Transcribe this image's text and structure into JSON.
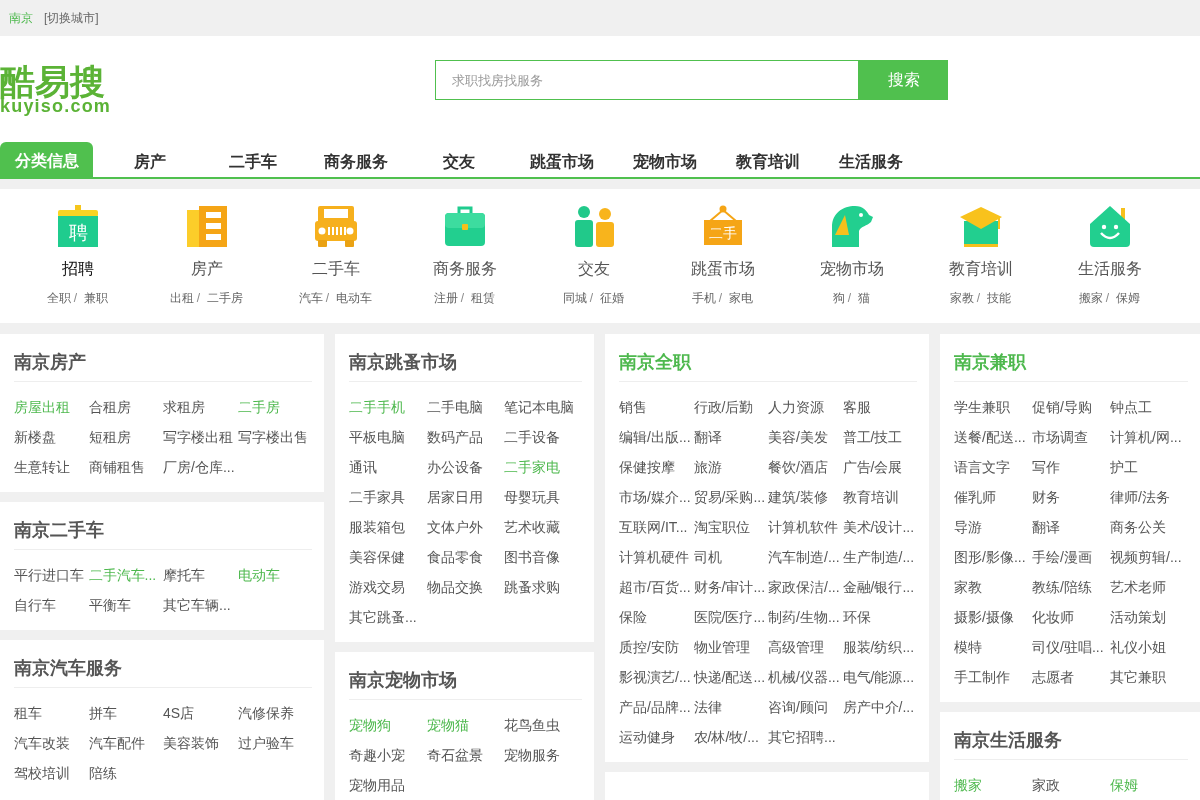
{
  "top_bar": {
    "city": "南京",
    "switch_city": "[切换城市]"
  },
  "logo": {
    "name": "酷易搜",
    "domain": "kuyiso.com"
  },
  "search": {
    "placeholder": "求职找房找服务",
    "button": "搜索"
  },
  "nav": [
    {
      "label": "分类信息",
      "selected": true
    },
    {
      "label": "房产",
      "selected": false
    },
    {
      "label": "二手车",
      "selected": false
    },
    {
      "label": "商务服务",
      "selected": false
    },
    {
      "label": "交友",
      "selected": false
    },
    {
      "label": "跳蛋市场",
      "selected": false
    },
    {
      "label": "宠物市场",
      "selected": false
    },
    {
      "label": "教育培训",
      "selected": false
    },
    {
      "label": "生活服务",
      "selected": false
    }
  ],
  "categories": [
    {
      "title": "招聘",
      "selected": true,
      "icon_text": "聘",
      "links": [
        "全职",
        "兼职"
      ],
      "separator": "/"
    },
    {
      "title": "房产",
      "selected": false,
      "links": [
        "出租",
        "二手房"
      ],
      "separator": "/"
    },
    {
      "title": "二手车",
      "selected": false,
      "links": [
        "汽车",
        "电动车"
      ],
      "separator": "/"
    },
    {
      "title": "商务服务",
      "selected": false,
      "links": [
        "注册",
        "租赁"
      ],
      "separator": "/"
    },
    {
      "title": "交友",
      "selected": false,
      "links": [
        "同城",
        "征婚"
      ],
      "separator": "/"
    },
    {
      "title": "跳蛋市场",
      "selected": false,
      "icon_text": "二手",
      "links": [
        "手机",
        "家电"
      ],
      "separator": "/"
    },
    {
      "title": "宠物市场",
      "selected": false,
      "links": [
        "狗",
        "猫"
      ],
      "separator": "/"
    },
    {
      "title": "教育培训",
      "selected": false,
      "links": [
        "家教",
        "技能"
      ],
      "separator": "/"
    },
    {
      "title": "生活服务",
      "selected": false,
      "links": [
        "搬家",
        "保姆"
      ],
      "separator": "/"
    }
  ],
  "columns": [
    {
      "cards": [
        {
          "kind": "section",
          "title": "南京房产",
          "highlighted": false,
          "items": [
            {
              "label": "房屋出租",
              "highlighted": true
            },
            {
              "label": "合租房",
              "highlighted": false
            },
            {
              "label": "求租房",
              "highlighted": false
            },
            {
              "label": "二手房",
              "highlighted": true
            },
            {
              "label": "新楼盘",
              "highlighted": false
            },
            {
              "label": "短租房",
              "highlighted": false
            },
            {
              "label": "写字楼出租",
              "highlighted": false
            },
            {
              "label": "写字楼出售",
              "highlighted": false
            },
            {
              "label": "生意转让",
              "highlighted": false
            },
            {
              "label": "商铺租售",
              "highlighted": false
            },
            {
              "label": "厂房/仓库...",
              "highlighted": false
            }
          ]
        },
        {
          "kind": "section",
          "title": "南京二手车",
          "highlighted": false,
          "items": [
            {
              "label": "平行进口车",
              "highlighted": false
            },
            {
              "label": "二手汽车...",
              "highlighted": true
            },
            {
              "label": "摩托车",
              "highlighted": false
            },
            {
              "label": "电动车",
              "highlighted": true
            },
            {
              "label": "自行车",
              "highlighted": false
            },
            {
              "label": "平衡车",
              "highlighted": false
            },
            {
              "label": "其它车辆...",
              "highlighted": false
            }
          ]
        },
        {
          "kind": "section",
          "title": "南京汽车服务",
          "highlighted": false,
          "items": [
            {
              "label": "租车",
              "highlighted": false
            },
            {
              "label": "拼车",
              "highlighted": false
            },
            {
              "label": "4S店",
              "highlighted": false
            },
            {
              "label": "汽修保养",
              "highlighted": false
            },
            {
              "label": "汽车改装",
              "highlighted": false
            },
            {
              "label": "汽车配件",
              "highlighted": false
            },
            {
              "label": "美容装饰",
              "highlighted": false
            },
            {
              "label": "过户验车",
              "highlighted": false
            },
            {
              "label": "驾校培训",
              "highlighted": false
            },
            {
              "label": "陪练",
              "highlighted": false
            }
          ]
        }
      ]
    },
    {
      "cards": [
        {
          "kind": "section",
          "title": "南京跳蚤市场",
          "highlighted": false,
          "items": [
            {
              "label": "二手手机",
              "highlighted": true
            },
            {
              "label": "二手电脑",
              "highlighted": false
            },
            {
              "label": "笔记本电脑",
              "highlighted": false
            },
            {
              "label": "平板电脑",
              "highlighted": false
            },
            {
              "label": "数码产品",
              "highlighted": false
            },
            {
              "label": "二手设备",
              "highlighted": false
            },
            {
              "label": "通讯",
              "highlighted": false
            },
            {
              "label": "办公设备",
              "highlighted": false
            },
            {
              "label": "二手家电",
              "highlighted": true
            },
            {
              "label": "二手家具",
              "highlighted": false
            },
            {
              "label": "居家日用",
              "highlighted": false
            },
            {
              "label": "母婴玩具",
              "highlighted": false
            },
            {
              "label": "服装箱包",
              "highlighted": false
            },
            {
              "label": "文体户外",
              "highlighted": false
            },
            {
              "label": "艺术收藏",
              "highlighted": false
            },
            {
              "label": "美容保健",
              "highlighted": false
            },
            {
              "label": "食品零食",
              "highlighted": false
            },
            {
              "label": "图书音像",
              "highlighted": false
            },
            {
              "label": "游戏交易",
              "highlighted": false
            },
            {
              "label": "物品交换",
              "highlighted": false
            },
            {
              "label": "跳蚤求购",
              "highlighted": false
            },
            {
              "label": "其它跳蚤...",
              "highlighted": false
            }
          ]
        },
        {
          "kind": "section",
          "title": "南京宠物市场",
          "highlighted": false,
          "items": [
            {
              "label": "宠物狗",
              "highlighted": true
            },
            {
              "label": "宠物猫",
              "highlighted": true
            },
            {
              "label": "花鸟鱼虫",
              "highlighted": false
            },
            {
              "label": "奇趣小宠",
              "highlighted": false
            },
            {
              "label": "奇石盆景",
              "highlighted": false
            },
            {
              "label": "宠物服务",
              "highlighted": false
            },
            {
              "label": "宠物用品",
              "highlighted": false
            }
          ]
        }
      ]
    },
    {
      "cards": [
        {
          "kind": "section",
          "title": "南京全职",
          "highlighted": true,
          "items": [
            {
              "label": "销售",
              "highlighted": false
            },
            {
              "label": "行政/后勤",
              "highlighted": false
            },
            {
              "label": "人力资源",
              "highlighted": false
            },
            {
              "label": "客服",
              "highlighted": false
            },
            {
              "label": "编辑/出版...",
              "highlighted": false
            },
            {
              "label": "翻译",
              "highlighted": false
            },
            {
              "label": "美容/美发",
              "highlighted": false
            },
            {
              "label": "普工/技工",
              "highlighted": false
            },
            {
              "label": "保健按摩",
              "highlighted": false
            },
            {
              "label": "旅游",
              "highlighted": false
            },
            {
              "label": "餐饮/酒店",
              "highlighted": false
            },
            {
              "label": "广告/会展",
              "highlighted": false
            },
            {
              "label": "市场/媒介...",
              "highlighted": false
            },
            {
              "label": "贸易/采购...",
              "highlighted": false
            },
            {
              "label": "建筑/装修",
              "highlighted": false
            },
            {
              "label": "教育培训",
              "highlighted": false
            },
            {
              "label": "互联网/IT...",
              "highlighted": false
            },
            {
              "label": "淘宝职位",
              "highlighted": false
            },
            {
              "label": "计算机软件",
              "highlighted": false
            },
            {
              "label": "美术/设计...",
              "highlighted": false
            },
            {
              "label": "计算机硬件",
              "highlighted": false
            },
            {
              "label": "司机",
              "highlighted": false
            },
            {
              "label": "汽车制造/...",
              "highlighted": false
            },
            {
              "label": "生产制造/...",
              "highlighted": false
            },
            {
              "label": "超市/百货...",
              "highlighted": false
            },
            {
              "label": "财务/审计...",
              "highlighted": false
            },
            {
              "label": "家政保洁/...",
              "highlighted": false
            },
            {
              "label": "金融/银行...",
              "highlighted": false
            },
            {
              "label": "保险",
              "highlighted": false
            },
            {
              "label": "医院/医疗...",
              "highlighted": false
            },
            {
              "label": "制药/生物...",
              "highlighted": false
            },
            {
              "label": "环保",
              "highlighted": false
            },
            {
              "label": "质控/安防",
              "highlighted": false
            },
            {
              "label": "物业管理",
              "highlighted": false
            },
            {
              "label": "高级管理",
              "highlighted": false
            },
            {
              "label": "服装/纺织...",
              "highlighted": false
            },
            {
              "label": "影视演艺/...",
              "highlighted": false
            },
            {
              "label": "快递/配送...",
              "highlighted": false
            },
            {
              "label": "机械/仪器...",
              "highlighted": false
            },
            {
              "label": "电气/能源...",
              "highlighted": false
            },
            {
              "label": "产品/品牌...",
              "highlighted": false
            },
            {
              "label": "法律",
              "highlighted": false
            },
            {
              "label": "咨询/顾问",
              "highlighted": false
            },
            {
              "label": "房产中介/...",
              "highlighted": false
            },
            {
              "label": "运动健身",
              "highlighted": false
            },
            {
              "label": "农/林/牧/...",
              "highlighted": false
            },
            {
              "label": "其它招聘...",
              "highlighted": false
            }
          ]
        },
        {
          "kind": "cut_off"
        }
      ]
    },
    {
      "cards": [
        {
          "kind": "section",
          "title": "南京兼职",
          "highlighted": true,
          "items": [
            {
              "label": "学生兼职",
              "highlighted": false
            },
            {
              "label": "促销/导购",
              "highlighted": false
            },
            {
              "label": "钟点工",
              "highlighted": false
            },
            {
              "label": "送餐/配送...",
              "highlighted": false
            },
            {
              "label": "市场调查",
              "highlighted": false
            },
            {
              "label": "计算机/网...",
              "highlighted": false
            },
            {
              "label": "语言文字",
              "highlighted": false
            },
            {
              "label": "写作",
              "highlighted": false
            },
            {
              "label": "护工",
              "highlighted": false
            },
            {
              "label": "催乳师",
              "highlighted": false
            },
            {
              "label": "财务",
              "highlighted": false
            },
            {
              "label": "律师/法务",
              "highlighted": false
            },
            {
              "label": "导游",
              "highlighted": false
            },
            {
              "label": "翻译",
              "highlighted": false
            },
            {
              "label": "商务公关",
              "highlighted": false
            },
            {
              "label": "图形/影像...",
              "highlighted": false
            },
            {
              "label": "手绘/漫画",
              "highlighted": false
            },
            {
              "label": "视频剪辑/...",
              "highlighted": false
            },
            {
              "label": "家教",
              "highlighted": false
            },
            {
              "label": "教练/陪练",
              "highlighted": false
            },
            {
              "label": "艺术老师",
              "highlighted": false
            },
            {
              "label": "摄影/摄像",
              "highlighted": false
            },
            {
              "label": "化妆师",
              "highlighted": false
            },
            {
              "label": "活动策划",
              "highlighted": false
            },
            {
              "label": "模特",
              "highlighted": false
            },
            {
              "label": "司仪/驻唱...",
              "highlighted": false
            },
            {
              "label": "礼仪小姐",
              "highlighted": false
            },
            {
              "label": "手工制作",
              "highlighted": false
            },
            {
              "label": "志愿者",
              "highlighted": false
            },
            {
              "label": "其它兼职",
              "highlighted": false
            }
          ]
        },
        {
          "kind": "section",
          "title": "南京生活服务",
          "highlighted": false,
          "items": [
            {
              "label": "搬家",
              "highlighted": true
            },
            {
              "label": "家政",
              "highlighted": false
            },
            {
              "label": "保姆",
              "highlighted": true
            }
          ]
        }
      ]
    }
  ]
}
